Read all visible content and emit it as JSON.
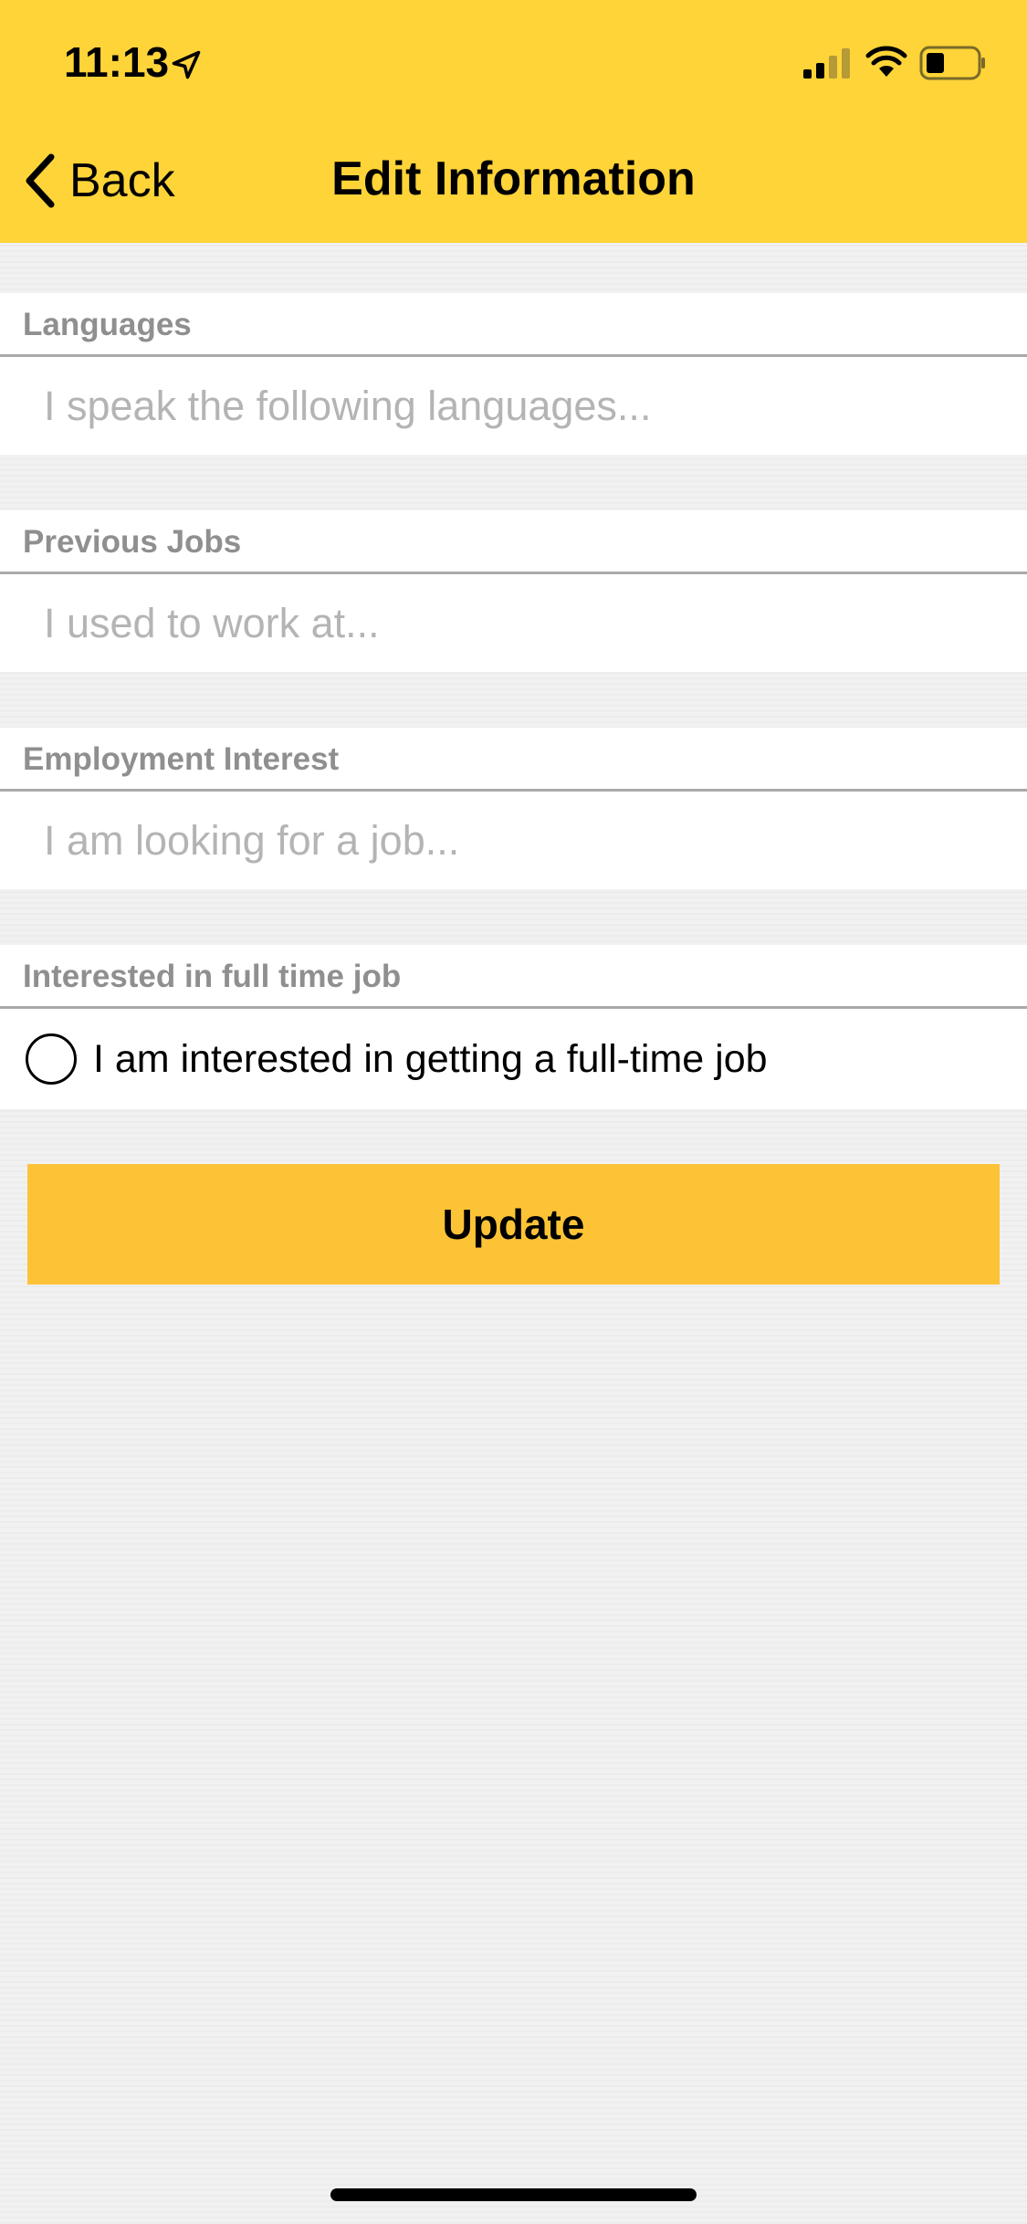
{
  "status_bar": {
    "time": "11:13"
  },
  "nav": {
    "back_label": "Back",
    "title": "Edit Information"
  },
  "form": {
    "languages": {
      "label": "Languages",
      "placeholder": "I speak the following languages...",
      "value": ""
    },
    "previous_jobs": {
      "label": "Previous Jobs",
      "placeholder": "I used to work at...",
      "value": ""
    },
    "employment_interest": {
      "label": "Employment Interest",
      "placeholder": "I am looking for a job...",
      "value": ""
    },
    "full_time": {
      "label": "Interested in full time job",
      "option_label": "I am interested in getting a full-time job",
      "checked": false
    }
  },
  "update_button": {
    "label": "Update"
  },
  "colors": {
    "header_bg": "#fed438",
    "button_bg": "#fdc336",
    "page_bg": "#f1f1f1",
    "label_text": "#8f8f8f",
    "placeholder_text": "#b4b4b4"
  },
  "icons": [
    "location-arrow-icon",
    "cellular-signal-icon",
    "wifi-icon",
    "battery-icon",
    "chevron-left-icon",
    "radio-unchecked-icon"
  ]
}
